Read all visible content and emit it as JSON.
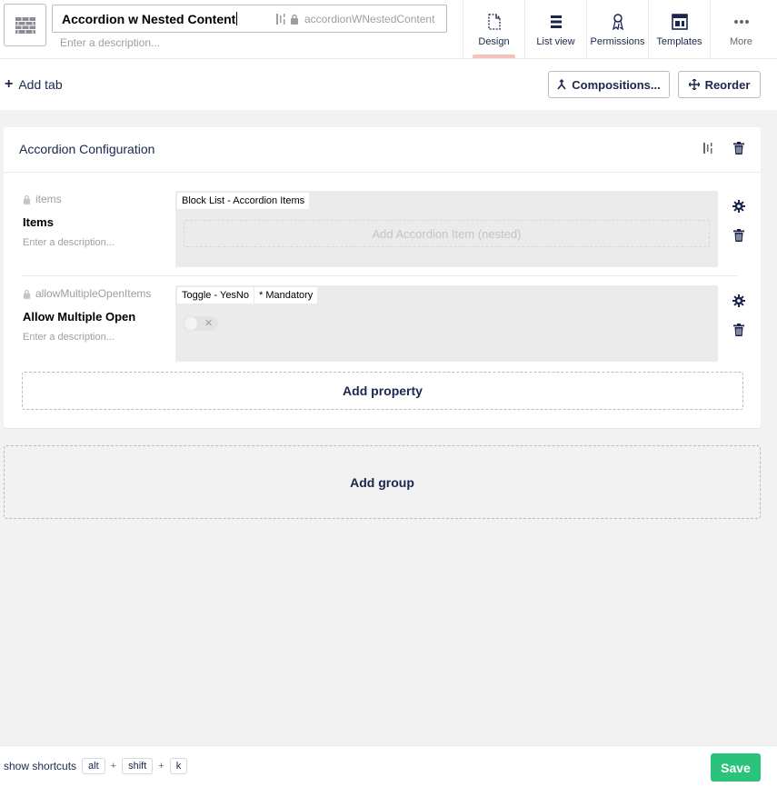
{
  "header": {
    "name_value": "Accordion w Nested Content",
    "alias": "accordionWNestedContent",
    "description_placeholder": "Enter a description..."
  },
  "nav": [
    {
      "label": "Design",
      "icon": "document-icon",
      "active": true
    },
    {
      "label": "List view",
      "icon": "list-icon",
      "active": false
    },
    {
      "label": "Permissions",
      "icon": "permissions-icon",
      "active": false
    },
    {
      "label": "Templates",
      "icon": "templates-icon",
      "active": false
    },
    {
      "label": "More",
      "icon": "more-icon",
      "active": false
    }
  ],
  "toolbar": {
    "add_tab": "Add tab",
    "compositions": "Compositions...",
    "reorder": "Reorder"
  },
  "group": {
    "title": "Accordion Configuration",
    "properties": [
      {
        "alias": "items",
        "name": "Items",
        "description_placeholder": "Enter a description...",
        "editor": "Block List - Accordion Items",
        "nested_add": "Add Accordion Item (nested)"
      },
      {
        "alias": "allowMultipleOpenItems",
        "name": "Allow Multiple Open",
        "description_placeholder": "Enter a description...",
        "editor": "Toggle - YesNo",
        "mandatory": "* Mandatory"
      }
    ],
    "add_property": "Add property"
  },
  "add_group": "Add group",
  "footer": {
    "show_shortcuts": "show shortcuts",
    "keys": [
      "alt",
      "shift",
      "k"
    ],
    "plus": "+",
    "save": "Save"
  },
  "colors": {
    "primary_text": "#1b264f",
    "save_green": "#2bc37c",
    "active_tab_indicator": "#f5c1bc"
  }
}
